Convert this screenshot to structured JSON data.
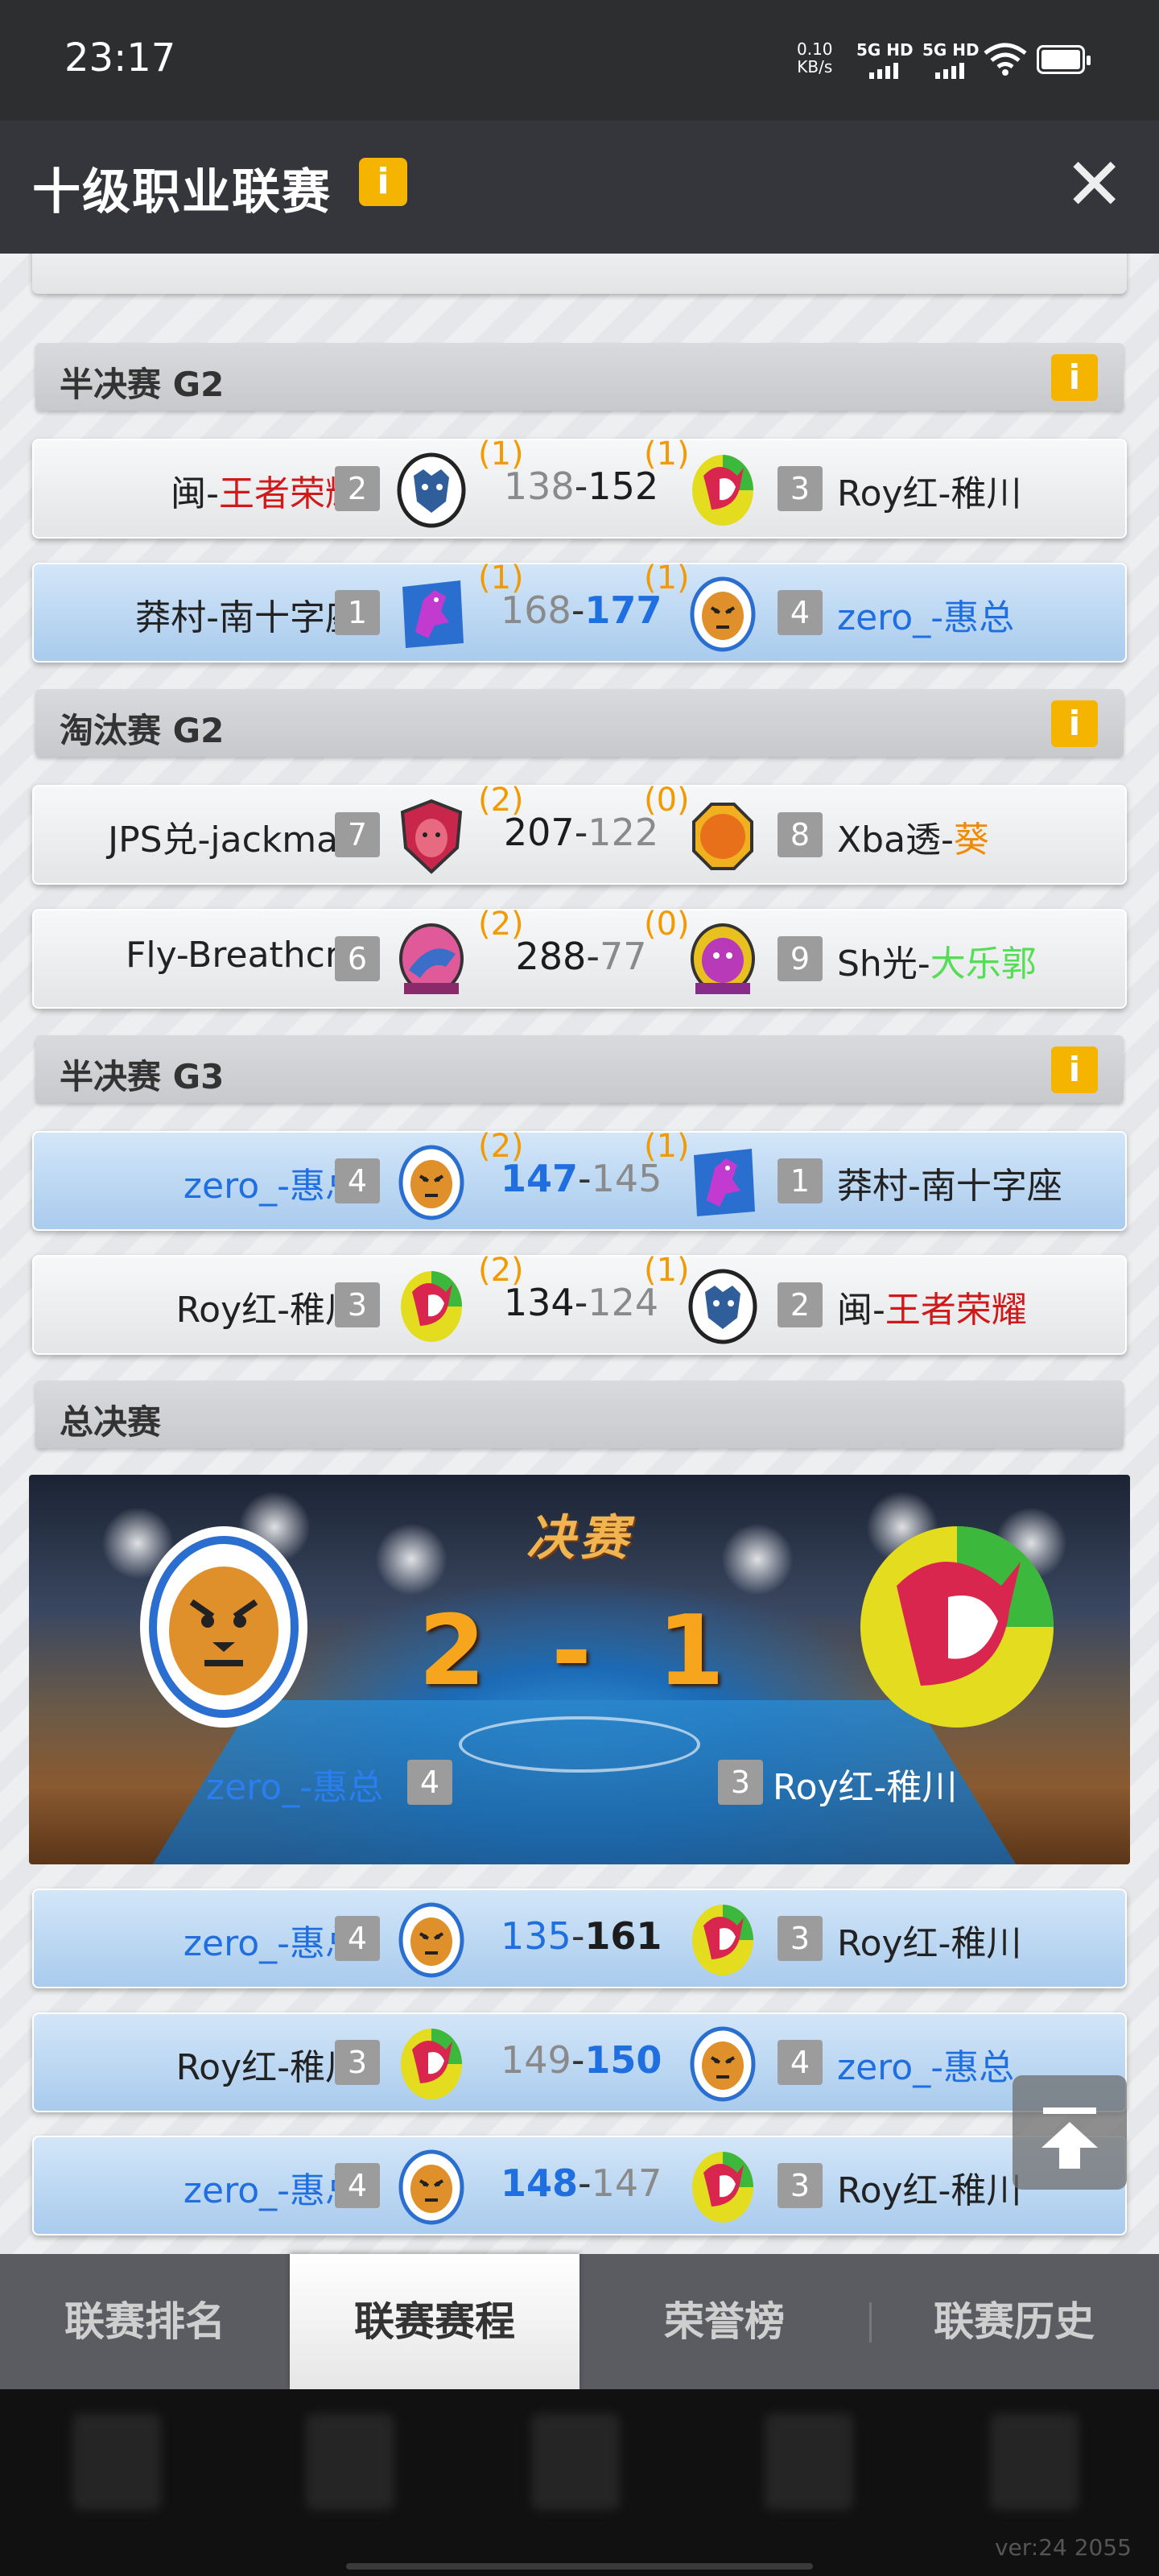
{
  "status_bar": {
    "time": "23:17",
    "net_speed_value": "0.10",
    "net_speed_unit": "KB/s",
    "signal_1": "5G HD",
    "signal_2": "5G HD"
  },
  "header": {
    "title": "十级职业联赛",
    "info_label": "i",
    "close_label": "✕"
  },
  "sections": [
    {
      "label": "半决赛 G2",
      "info": "i"
    },
    {
      "label": "淘汰赛 G2",
      "info": "i"
    },
    {
      "label": "半决赛 G3",
      "info": "i"
    },
    {
      "label": "总决赛"
    }
  ],
  "matches": [
    {
      "left_pre": "闽-",
      "left_hl": "王者荣耀",
      "left_seed": "2",
      "left_wins": "(1)",
      "left_score": "138",
      "right_score": "152",
      "right_wins": "(1)",
      "right_seed": "3",
      "right_pre": "Roy红-稚川",
      "right_hl": ""
    },
    {
      "left_pre": "莽村-南十字座",
      "left_hl": "",
      "left_seed": "1",
      "left_wins": "(1)",
      "left_score": "168",
      "right_score": "177",
      "right_wins": "(1)",
      "right_seed": "4",
      "right_pre": "zero_-惠总",
      "right_hl": ""
    },
    {
      "left_pre": "JPS兑-jackman",
      "left_hl": "",
      "left_seed": "7",
      "left_wins": "(2)",
      "left_score": "207",
      "right_score": "122",
      "right_wins": "(0)",
      "right_seed": "8",
      "right_pre": "Xba透-",
      "right_hl": "葵"
    },
    {
      "left_pre": "Fly-Breathcry",
      "left_hl": "",
      "left_seed": "6",
      "left_wins": "(2)",
      "left_score": "288",
      "right_score": "77",
      "right_wins": "(0)",
      "right_seed": "9",
      "right_pre": "Sh光-",
      "right_hl": "大乐郭"
    },
    {
      "left_pre": "zero_-惠总",
      "left_hl": "",
      "left_seed": "4",
      "left_wins": "(2)",
      "left_score": "147",
      "right_score": "145",
      "right_wins": "(1)",
      "right_seed": "1",
      "right_pre": "莽村-南十字座",
      "right_hl": ""
    },
    {
      "left_pre": "Roy红-稚川",
      "left_hl": "",
      "left_seed": "3",
      "left_wins": "(2)",
      "left_score": "134",
      "right_score": "124",
      "right_wins": "(1)",
      "right_seed": "2",
      "right_pre": "闽-",
      "right_hl": "王者荣耀"
    },
    {
      "left_pre": "zero_-惠总",
      "left_hl": "",
      "left_seed": "4",
      "left_score": "135",
      "right_score": "161",
      "right_seed": "3",
      "right_pre": "Roy红-稚川",
      "right_hl": ""
    },
    {
      "left_pre": "Roy红-稚川",
      "left_hl": "",
      "left_seed": "3",
      "left_score": "149",
      "right_score": "150",
      "right_seed": "4",
      "right_pre": "zero_-惠总",
      "right_hl": ""
    },
    {
      "left_pre": "zero_-惠总",
      "left_hl": "",
      "left_seed": "4",
      "left_score": "148",
      "right_score": "147",
      "right_seed": "3",
      "right_pre": "Roy红-稚川",
      "right_hl": ""
    }
  ],
  "final": {
    "title": "决赛",
    "score": "2 - 1",
    "left_name": "zero_-惠总",
    "left_seed": "4",
    "right_name": "Roy红-稚川",
    "right_seed": "3"
  },
  "tabs": [
    {
      "label": "联赛排名",
      "active": false
    },
    {
      "label": "联赛赛程",
      "active": true
    },
    {
      "label": "荣誉榜",
      "active": false
    },
    {
      "label": "联赛历史",
      "active": false
    }
  ],
  "version": "ver:24  2055",
  "colors": {
    "accent_blue": "#1f6fe0",
    "win_count_orange": "#f29a00",
    "info_badge": "#f5b400",
    "highlight_red": "#d01a1a"
  }
}
